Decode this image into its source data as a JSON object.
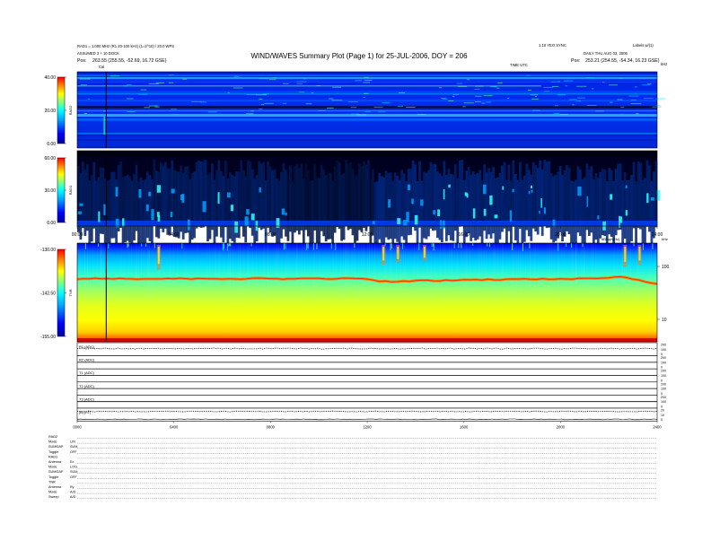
{
  "header": {
    "title": "WIND/WAVES Summary Plot (Page 1) for 25-JUL-2006, DOY = 206",
    "left_line1": "RAD1 = 1.000 MHz (R1 20-100 kHz) (1=2^10) / 20.0 WPS",
    "left_line2": "ASSUMED 3 + 10 DOCK",
    "left_pos_label": "Pos:",
    "left_pos": "263.55 (255.55, -52.69, 16.72 GSE)",
    "right_line1": "1.10 YEO SYNC",
    "right_line2": "Labels w/(1)",
    "right_line3": "DAILY THU AUG 03, 2006",
    "right_pos_label": "Pos:",
    "right_pos": "253.21 (254.55, -54.34, 16.23 GSE)",
    "sub_left": "Cal",
    "sub_center": "TIME UTC",
    "sub_right": "kHz"
  },
  "chart_data": [
    {
      "type": "heatmap",
      "name_label": "RAD2",
      "colorbar_ticks": [
        "0.00",
        "20.00",
        "40.00"
      ],
      "colorbar_range": [
        0,
        40
      ],
      "x_range": [
        0,
        24
      ],
      "cal_marker_hour": 1.2
    },
    {
      "type": "heatmap",
      "name_label": "RAD1",
      "colorbar_ticks": [
        "0.00",
        "30.00",
        "60.00"
      ],
      "colorbar_range": [
        0,
        60
      ],
      "x_range": [
        0,
        24
      ],
      "x_ticks": [
        "00:00",
        "04:00",
        "08:00",
        "12:00",
        "16:00",
        "20:00",
        "24:00"
      ],
      "cal_marker_hour": 1.2
    },
    {
      "type": "heatmap",
      "name_label": "TNR",
      "colorbar_ticks": [
        "-155.00",
        "-142.50",
        "-130.00"
      ],
      "colorbar_range": [
        -155,
        -130
      ],
      "right_axis_ticks": [
        "100",
        "10"
      ],
      "right_axis_label": "kHz",
      "top_right_label": "dB/sqrt(Hz)",
      "x_range": [
        0,
        24
      ],
      "cal_marker_hour": 1.2,
      "band_line_hours": [
        0,
        12,
        12.5,
        17,
        21,
        22.5,
        23.5,
        24
      ],
      "band_line_frac": [
        0.36,
        0.36,
        0.39,
        0.37,
        0.36,
        0.34,
        0.39,
        0.41
      ]
    },
    {
      "type": "line",
      "panels": [
        {
          "label": "R1 (ADC)",
          "right_ticks": [
            "200",
            "100",
            "0"
          ],
          "level": 0.45,
          "noise": 0.04,
          "style": "dotted"
        },
        {
          "label": "R2 (ADC)",
          "right_ticks": [
            "200",
            "100",
            "0"
          ],
          "level": 0.5,
          "noise": 0.0,
          "style": "flat"
        },
        {
          "label": "T1 (ADC)",
          "right_ticks": [
            "200",
            "100",
            "0"
          ],
          "level": 0.5,
          "noise": 0.0,
          "style": "flat"
        },
        {
          "label": "T2 (ADC)",
          "right_ticks": [
            "200",
            "100",
            "0"
          ],
          "level": 0.5,
          "noise": 0.0,
          "style": "flat"
        },
        {
          "label": "T3 (ADC)",
          "right_ticks": [
            "200",
            "100",
            "0"
          ],
          "level": 0.5,
          "noise": 0.0,
          "style": "flat"
        },
        {
          "label": "|B| (nT)",
          "right_ticks": [
            "20",
            "10",
            "0"
          ],
          "level": 0.25,
          "noise": 0.03,
          "style": "dotted2"
        }
      ],
      "x_ticks": [
        "0000",
        "0400",
        "0800",
        "1200",
        "1600",
        "2000",
        "2400"
      ]
    }
  ],
  "settings": [
    {
      "label": "RAD2",
      "value": ""
    },
    {
      "label": "Mode",
      "value": "LIN"
    },
    {
      "label": "SUMGAP",
      "value": "SUM"
    },
    {
      "label": "Toggle",
      "value": "OFF"
    },
    {
      "label": "RAD1",
      "value": ""
    },
    {
      "label": "Antenna",
      "value": "Ex"
    },
    {
      "label": "Mode",
      "value": "LOG"
    },
    {
      "label": "SUMGAP",
      "value": "SUM"
    },
    {
      "label": "Toggle",
      "value": "OFF"
    },
    {
      "label": "TNR",
      "value": ""
    },
    {
      "label": "Antenna",
      "value": "Ey"
    },
    {
      "label": "Mode",
      "value": "A/D"
    },
    {
      "label": "Sweep",
      "value": "A/D"
    }
  ],
  "colors": {
    "scale": [
      "#000080",
      "#0000ff",
      "#0080ff",
      "#00ffff",
      "#80ff80",
      "#ffff00",
      "#ff8000",
      "#ff0000"
    ]
  }
}
